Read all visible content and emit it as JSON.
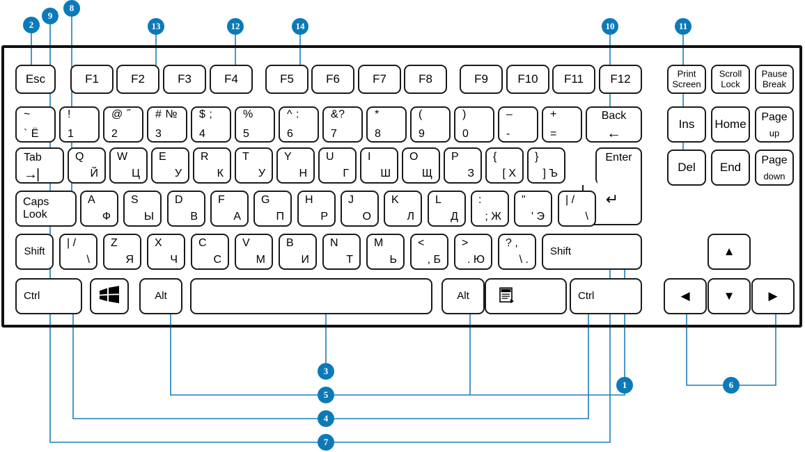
{
  "diagram": {
    "title": "Russian/English keyboard layout with numbered callouts",
    "accent_color": "#0c7ab8",
    "key_border_color": "#1a1a1a",
    "shell_border_color": "#111111"
  },
  "callouts": [
    {
      "id": "1",
      "number": "1"
    },
    {
      "id": "2",
      "number": "2"
    },
    {
      "id": "3",
      "number": "3"
    },
    {
      "id": "4",
      "number": "4"
    },
    {
      "id": "5",
      "number": "5"
    },
    {
      "id": "6",
      "number": "6"
    },
    {
      "id": "7",
      "number": "7"
    },
    {
      "id": "8",
      "number": "8"
    },
    {
      "id": "9",
      "number": "9"
    },
    {
      "id": "10",
      "number": "10"
    },
    {
      "id": "11",
      "number": "11"
    },
    {
      "id": "12",
      "number": "12"
    },
    {
      "id": "13",
      "number": "13"
    },
    {
      "id": "14",
      "number": "14"
    }
  ],
  "function_row": {
    "esc": "Esc",
    "f_keys": [
      "F1",
      "F2",
      "F3",
      "F4",
      "F5",
      "F6",
      "F7",
      "F8",
      "F9",
      "F10",
      "F11",
      "F12"
    ]
  },
  "number_row": [
    {
      "top": "~",
      "bottom": "` Ё"
    },
    {
      "top": "!",
      "bottom": "1"
    },
    {
      "top": "@ ˝",
      "bottom": "2"
    },
    {
      "top": "# №",
      "bottom": "3"
    },
    {
      "top": "$ ;",
      "bottom": "4"
    },
    {
      "top": "%",
      "bottom": "5"
    },
    {
      "top": "^ :",
      "bottom": "6"
    },
    {
      "top": "&?",
      "bottom": "7"
    },
    {
      "top": "*",
      "bottom": "8"
    },
    {
      "top": "(",
      "bottom": "9"
    },
    {
      "top": ")",
      "bottom": "0"
    },
    {
      "top": "–",
      "bottom": "-"
    },
    {
      "top": "+",
      "bottom": "="
    }
  ],
  "backspace": {
    "label": "Back",
    "glyph": "←"
  },
  "tab": {
    "label": "Tab",
    "glyph": "→|"
  },
  "qwerty_row": [
    {
      "latin": "Q",
      "cyrillic": "Й"
    },
    {
      "latin": "W",
      "cyrillic": "Ц"
    },
    {
      "latin": "E",
      "cyrillic": "У"
    },
    {
      "latin": "R",
      "cyrillic": "К"
    },
    {
      "latin": "T",
      "cyrillic": "У"
    },
    {
      "latin": "Y",
      "cyrillic": "Н"
    },
    {
      "latin": "U",
      "cyrillic": "Г"
    },
    {
      "latin": "I",
      "cyrillic": "Ш"
    },
    {
      "latin": "O",
      "cyrillic": "Щ"
    },
    {
      "latin": "P",
      "cyrillic": "З"
    },
    {
      "latin": "{",
      "cyrillic": "[ Х"
    },
    {
      "latin": "}",
      "cyrillic": "] Ъ"
    }
  ],
  "enter": {
    "label": "Enter",
    "glyph": "↵"
  },
  "capslock": {
    "line1": "Caps",
    "line2": "Look"
  },
  "home_row": [
    {
      "latin": "A",
      "cyrillic": "Ф"
    },
    {
      "latin": "S",
      "cyrillic": "Ы"
    },
    {
      "latin": "D",
      "cyrillic": "В"
    },
    {
      "latin": "F",
      "cyrillic": "А"
    },
    {
      "latin": "G",
      "cyrillic": "П"
    },
    {
      "latin": "H",
      "cyrillic": "Р"
    },
    {
      "latin": "J",
      "cyrillic": "О"
    },
    {
      "latin": "K",
      "cyrillic": "Л"
    },
    {
      "latin": "L",
      "cyrillic": "Д"
    },
    {
      "latin": ":",
      "cyrillic": "; Ж"
    },
    {
      "latin": "\"",
      "cyrillic": "' Э"
    },
    {
      "latin": "| /",
      "cyrillic": "\\"
    }
  ],
  "shift_left": "Shift",
  "shift_right": "Shift",
  "zxcv_row": [
    {
      "latin": "| /",
      "cyrillic": "\\"
    },
    {
      "latin": "Z",
      "cyrillic": "Я"
    },
    {
      "latin": "X",
      "cyrillic": "Ч"
    },
    {
      "latin": "C",
      "cyrillic": "С"
    },
    {
      "latin": "V",
      "cyrillic": "М"
    },
    {
      "latin": "B",
      "cyrillic": "И"
    },
    {
      "latin": "N",
      "cyrillic": "Т"
    },
    {
      "latin": "M",
      "cyrillic": "Ь"
    },
    {
      "latin": "<",
      "cyrillic": ", Б"
    },
    {
      "latin": ">",
      "cyrillic": ". Ю"
    },
    {
      "latin": "? ,",
      "cyrillic": "\\ ."
    }
  ],
  "bottom_row": {
    "ctrl_left": "Ctrl",
    "win": "windows-logo",
    "alt_left": "Alt",
    "space": "",
    "alt_right": "Alt",
    "menu": "context-menu-icon",
    "ctrl_right": "Ctrl"
  },
  "nav_cluster": [
    {
      "line1": "Print",
      "line2": "Screen"
    },
    {
      "line1": "Scroll",
      "line2": "Lock"
    },
    {
      "line1": "Pause",
      "line2": "Break"
    },
    {
      "line1": "Ins",
      "line2": ""
    },
    {
      "line1": "Home",
      "line2": ""
    },
    {
      "line1": "Page",
      "line2": "up"
    },
    {
      "line1": "Del",
      "line2": ""
    },
    {
      "line1": "End",
      "line2": ""
    },
    {
      "line1": "Page",
      "line2": "down"
    }
  ],
  "arrow_keys": {
    "up": "▲",
    "left": "◀",
    "down": "▼",
    "right": "▶"
  }
}
